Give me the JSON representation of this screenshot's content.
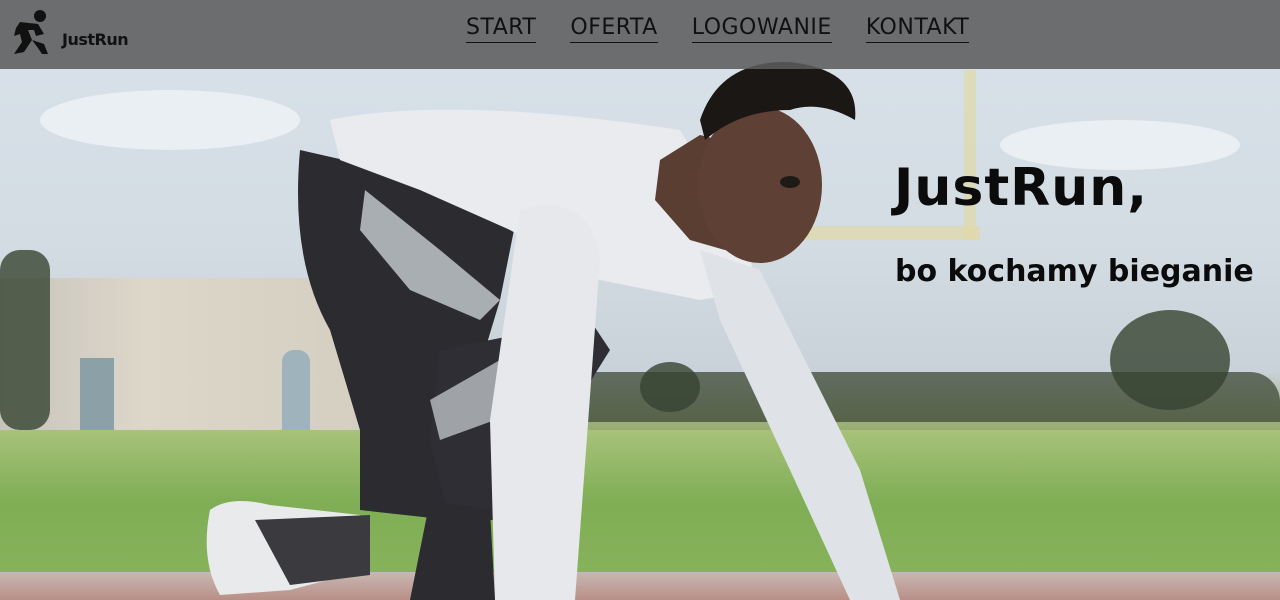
{
  "brand": {
    "name": "JustRun",
    "logo_icon": "runner-icon"
  },
  "nav": {
    "items": [
      {
        "label": "START"
      },
      {
        "label": "OFERTA"
      },
      {
        "label": "LOGOWANIE"
      },
      {
        "label": "KONTAKT"
      }
    ]
  },
  "hero": {
    "headline": "JustRun,",
    "subline": "bo kochamy bieganie",
    "image": "sprinter-in-starting-position"
  },
  "colors": {
    "navbar_bg": "#5c5c5c",
    "text": "#111111"
  }
}
